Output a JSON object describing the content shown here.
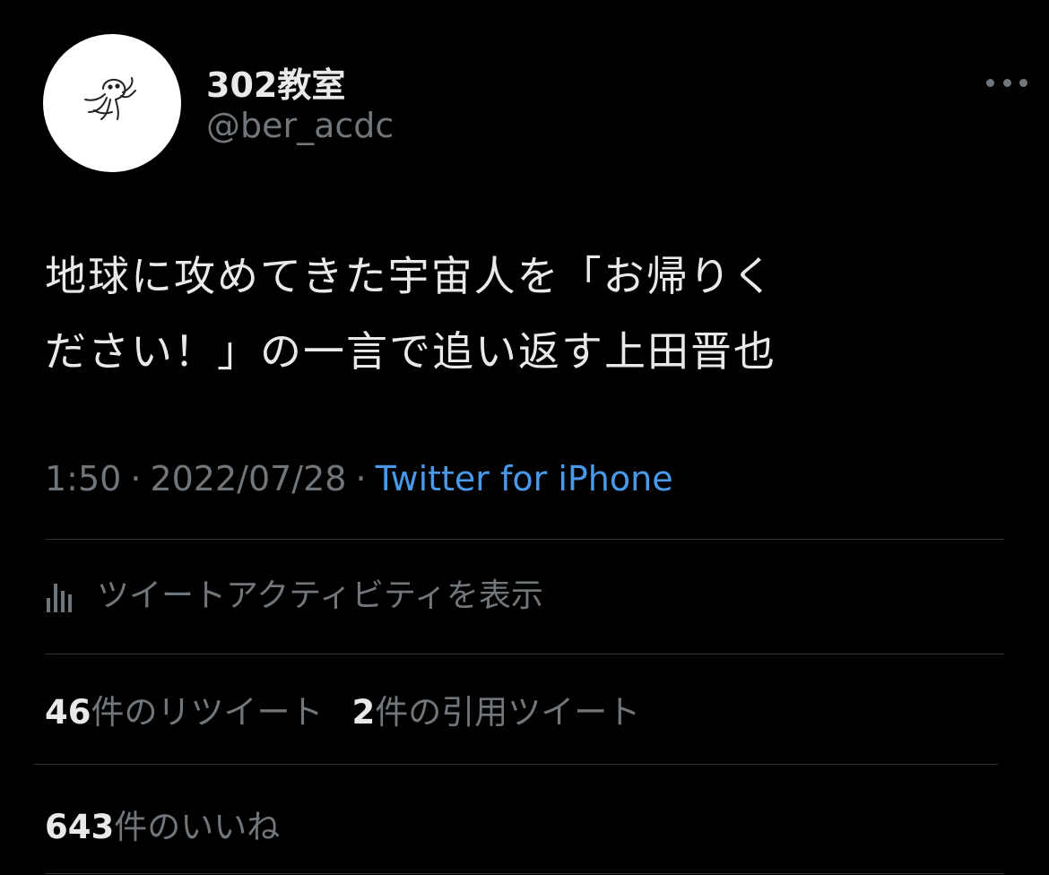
{
  "author": {
    "display_name": "302教室",
    "handle": "@ber_acdc",
    "avatar_icon": "octopus-sketch-icon"
  },
  "menu": {
    "more_icon": "more-horizontal-icon"
  },
  "tweet": {
    "line1": "地球に攻めてきた宇宙人を「お帰りく",
    "line2": "ださい！」の一言で追い返す上田晋也"
  },
  "meta": {
    "time": "1:50",
    "separator": "·",
    "date": "2022/07/28",
    "source": "Twitter for iPhone"
  },
  "activity": {
    "icon": "analytics-bar-icon",
    "label": "ツイートアクティビティを表示"
  },
  "stats": {
    "retweets_count": "46",
    "retweets_label": "件のリツイート",
    "quotes_count": "2",
    "quotes_label": "件の引用ツイート",
    "likes_count": "643",
    "likes_label": "件のいいね"
  },
  "colors": {
    "background": "#000000",
    "primary_text": "#e7e9ea",
    "secondary_text": "#71767b",
    "link": "#4a99e9",
    "divider": "#2f3336"
  }
}
